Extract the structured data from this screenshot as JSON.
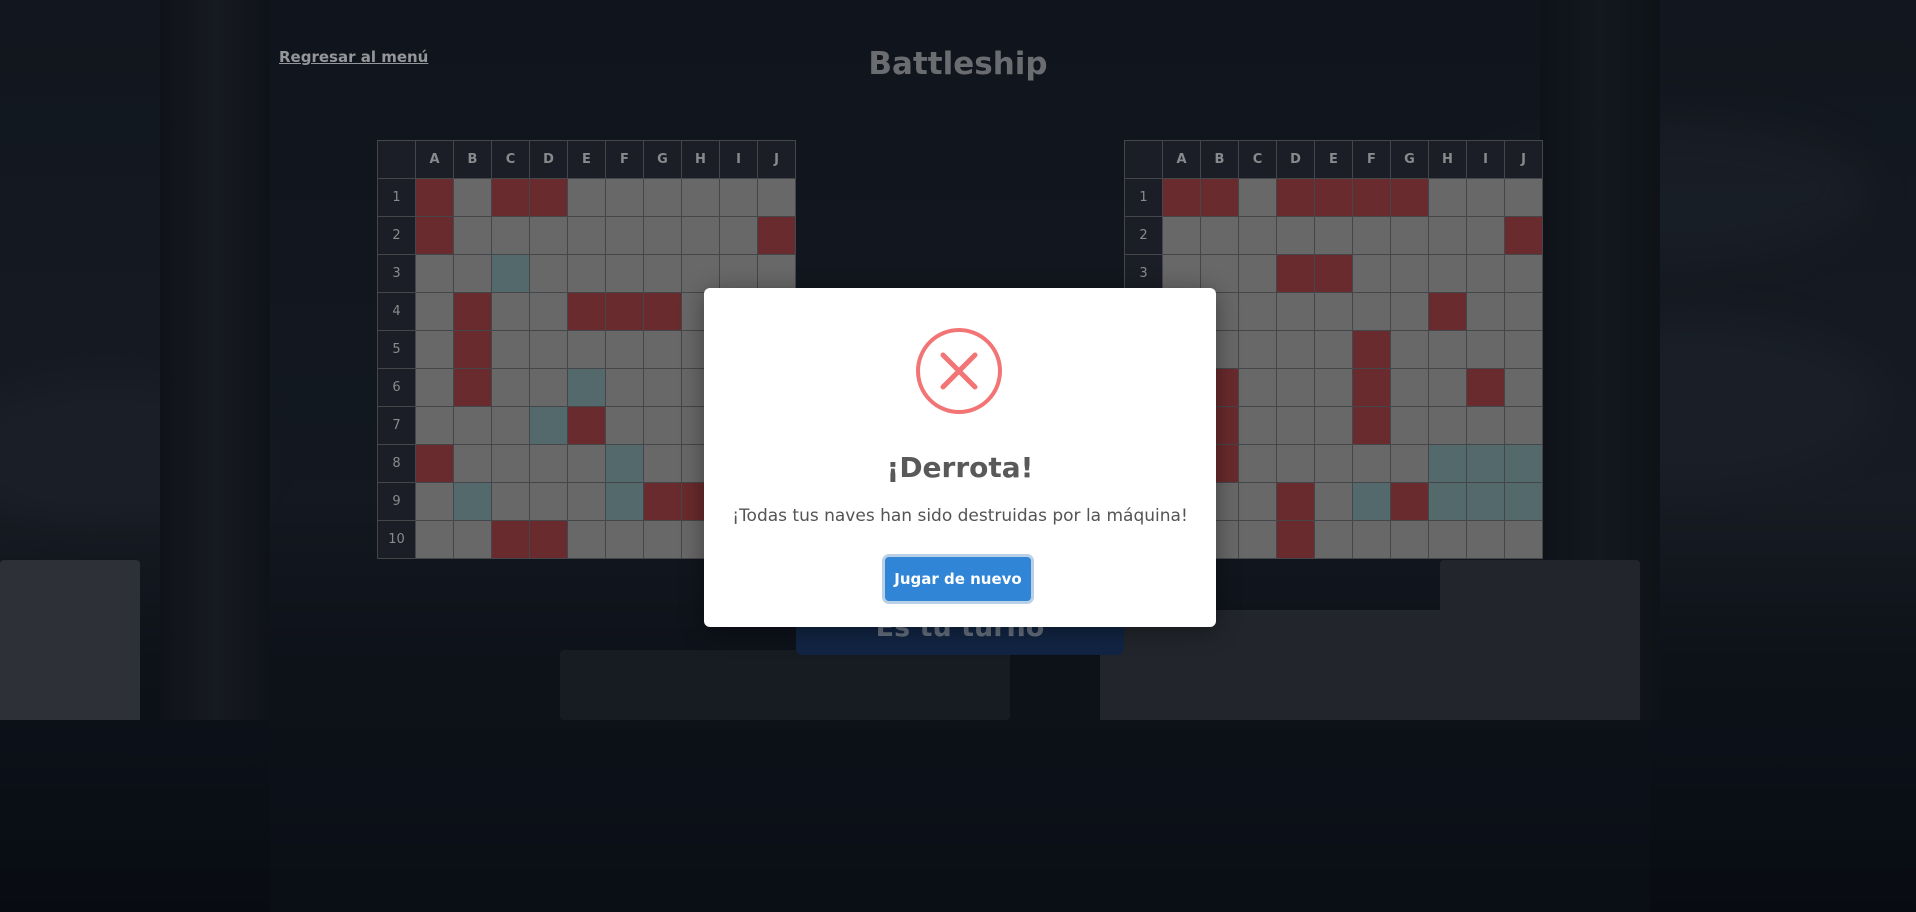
{
  "nav": {
    "back_label": "Regresar al menú"
  },
  "title": "Battleship",
  "columns": [
    "A",
    "B",
    "C",
    "D",
    "E",
    "F",
    "G",
    "H",
    "I",
    "J"
  ],
  "rows": [
    "1",
    "2",
    "3",
    "4",
    "5",
    "6",
    "7",
    "8",
    "9",
    "10"
  ],
  "legend_colors": {
    "water": "#8b8b8b",
    "hit": "#8c3a3d",
    "miss": "#6f8d91"
  },
  "board_left": [
    "h.hh......",
    "h........h",
    "..m.......",
    ".h..hhh...",
    ".h........",
    ".h..m.....",
    "...mh.....",
    "h....m....",
    ".m...mhh..",
    "..hh......"
  ],
  "board_right": [
    "hh.hhhh...",
    ".........h",
    "...hh.....",
    ".......h..",
    ".....h....",
    ".h...h..h.",
    ".h...h....",
    ".h.....mmm",
    "...h.mhmmm",
    "...h......"
  ],
  "turn_banner": "Es tu turno",
  "modal": {
    "icon": "error-x-icon",
    "title": "¡Derrota!",
    "message": "¡Todas tus naves han sido destruidas por la máquina!",
    "button_label": "Jugar de nuevo"
  }
}
